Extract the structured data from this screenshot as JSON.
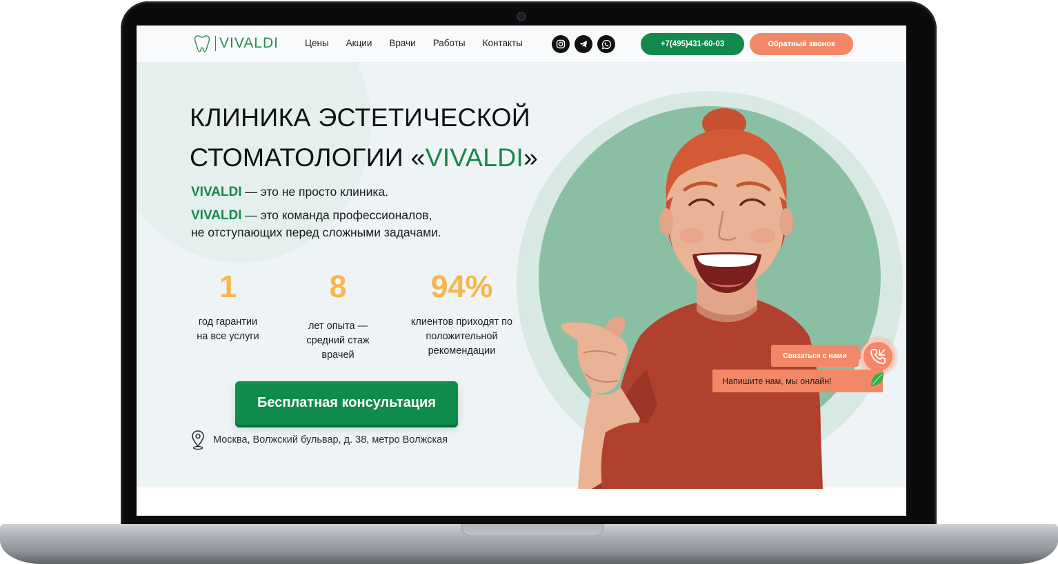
{
  "header": {
    "logo_text": "VIVALDI",
    "nav": [
      "Цены",
      "Акции",
      "Врачи",
      "Работы",
      "Контакты"
    ],
    "socials": [
      "instagram-icon",
      "telegram-icon",
      "whatsapp-icon"
    ],
    "phone": "+7(495)431-60-03",
    "callback": "Обратный звонок"
  },
  "hero": {
    "title_line1": "КЛИНИКА ЭСТЕТИЧЕСКОЙ",
    "title_line2_start": "СТОМАТОЛОГИИ «",
    "title_brand": "VIVALDI",
    "title_line2_end": "»",
    "lead1_brand": "VIVALDI",
    "lead1_text": " — это не просто клиника.",
    "lead2_brand": "VIVALDI",
    "lead2_text": " — это команда профессионалов,",
    "lead2_text2": "не отступающих перед сложными задачами.",
    "stats": [
      {
        "value": "1",
        "line1": "год гарантии",
        "line2": "на все услуги",
        "line3": ""
      },
      {
        "value": "8",
        "line1": "лет опыта —",
        "line2": "средний стаж",
        "line3": "врачей"
      },
      {
        "value": "94%",
        "line1": "клиентов приходят по",
        "line2": "положительной",
        "line3": "рекомендации"
      }
    ],
    "cta": "Бесплатная консультация",
    "address": "Москва, Волжский бульвар, д. 38, метро Волжская"
  },
  "chat": {
    "contact_label": "Связаться с нами",
    "online_label": "Напишите нам, мы онлайн!"
  },
  "colors": {
    "brand_green": "#16884a",
    "accent_orange": "#f38868",
    "stat_yellow": "#f7b64e",
    "hero_bg": "#eef4f6"
  }
}
